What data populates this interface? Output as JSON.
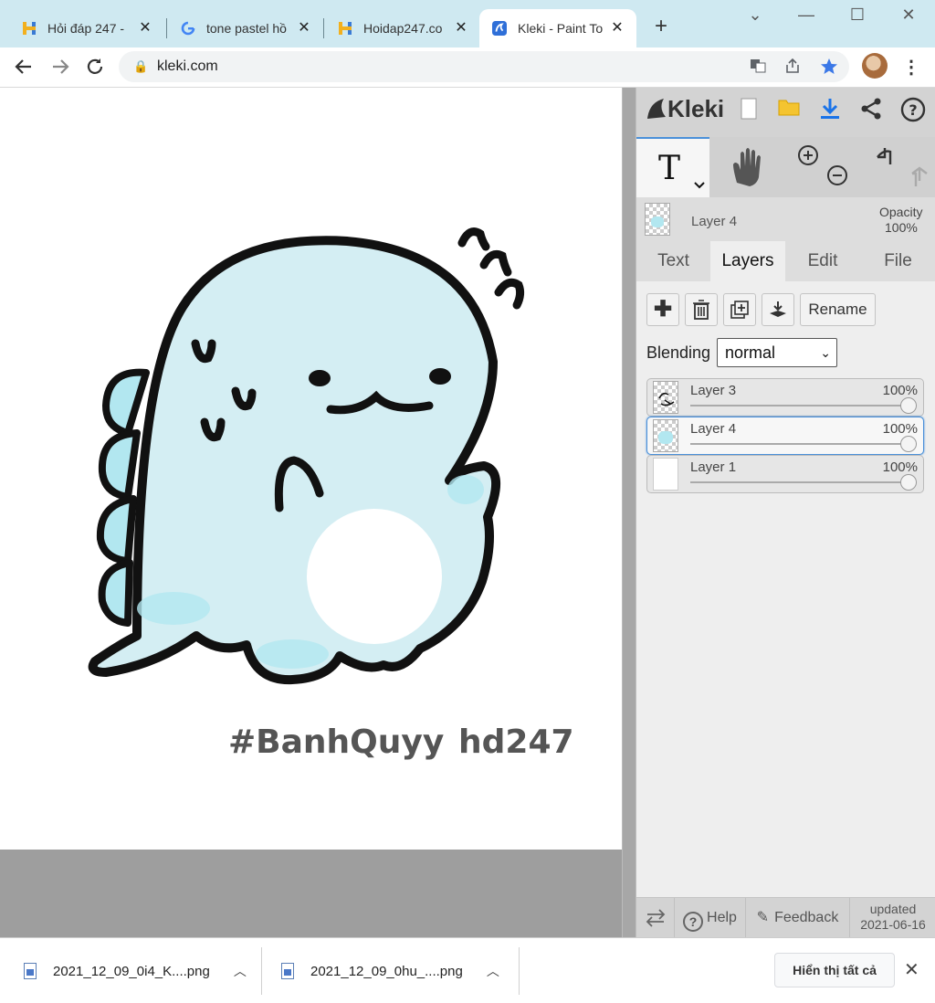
{
  "browser": {
    "tabs": [
      {
        "title": "Hỏi đáp 247 - ",
        "favicon": "hoidap-favicon",
        "active": false
      },
      {
        "title": "tone pastel hồ",
        "favicon": "google-favicon",
        "active": false
      },
      {
        "title": "Hoidap247.co",
        "favicon": "hoidap-favicon",
        "active": false
      },
      {
        "title": "Kleki - Paint To",
        "favicon": "kleki-favicon",
        "active": true
      }
    ],
    "url": "kleki.com",
    "new_tab_icon": "+",
    "colors": {
      "tabstrip": "#cfe9f1",
      "bookmark_star": "#3b78e7"
    }
  },
  "canvas": {
    "drawing_text": [
      "#BanhQuyy",
      "hd247"
    ],
    "colors": {
      "dino_fill": "#d4eef3",
      "dino_accent": "#b2e7f0",
      "outline": "#111111",
      "text": "#555555"
    }
  },
  "kleki": {
    "logo": "Kleki",
    "top_icons": [
      "new-image-icon",
      "open-folder-icon",
      "download-icon",
      "share-icon",
      "help-icon"
    ],
    "tools": [
      "text-tool",
      "hand-tool",
      "zoom-tool",
      "undo-redo"
    ],
    "current_layer": {
      "name": "Layer 4",
      "opacity_label": "Opacity",
      "opacity_value": "100%"
    },
    "tabs": [
      {
        "label": "Text",
        "active": false
      },
      {
        "label": "Layers",
        "active": true
      },
      {
        "label": "Edit",
        "active": false
      },
      {
        "label": "File",
        "active": false
      }
    ],
    "layer_buttons": {
      "rename": "Rename"
    },
    "blending": {
      "label": "Blending",
      "value": "normal"
    },
    "layers": [
      {
        "name": "Layer 3",
        "opacity": "100%",
        "opacity_fraction": 1.0,
        "selected": false
      },
      {
        "name": "Layer 4",
        "opacity": "100%",
        "opacity_fraction": 1.0,
        "selected": true
      },
      {
        "name": "Layer 1",
        "opacity": "100%",
        "opacity_fraction": 1.0,
        "selected": false
      }
    ],
    "bottom": {
      "help": "Help",
      "feedback": "Feedback",
      "updated_label": "updated",
      "updated_date": "2021-06-16"
    }
  },
  "downloads": {
    "items": [
      {
        "name": "2021_12_09_0i4_K....png"
      },
      {
        "name": "2021_12_09_0hu_....png"
      }
    ],
    "show_all": "Hiển thị tất cả"
  }
}
